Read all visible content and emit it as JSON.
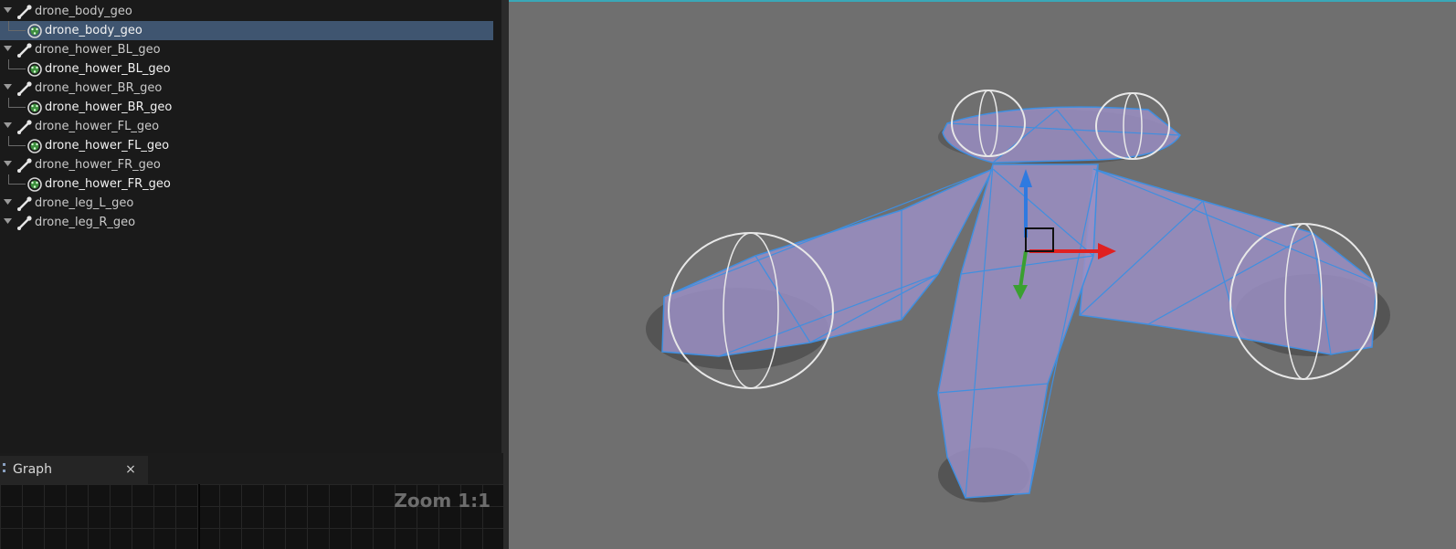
{
  "outliner": {
    "items": [
      {
        "label": "drone_body_geo",
        "type": "bone",
        "indent": 0,
        "selected": false
      },
      {
        "label": "drone_body_geo",
        "type": "mesh",
        "indent": 1,
        "selected": true
      },
      {
        "label": "drone_hower_BL_geo",
        "type": "bone",
        "indent": 0,
        "selected": false
      },
      {
        "label": "drone_hower_BL_geo",
        "type": "mesh",
        "indent": 1,
        "selected": false
      },
      {
        "label": "drone_hower_BR_geo",
        "type": "bone",
        "indent": 0,
        "selected": false
      },
      {
        "label": "drone_hower_BR_geo",
        "type": "mesh",
        "indent": 1,
        "selected": false
      },
      {
        "label": "drone_hower_FL_geo",
        "type": "bone",
        "indent": 0,
        "selected": false
      },
      {
        "label": "drone_hower_FL_geo",
        "type": "mesh",
        "indent": 1,
        "selected": false
      },
      {
        "label": "drone_hower_FR_geo",
        "type": "bone",
        "indent": 0,
        "selected": false
      },
      {
        "label": "drone_hower_FR_geo",
        "type": "mesh",
        "indent": 1,
        "selected": false
      },
      {
        "label": "drone_leg_L_geo",
        "type": "bone",
        "indent": 0,
        "selected": false
      },
      {
        "label": "drone_leg_R_geo",
        "type": "bone",
        "indent": 0,
        "selected": false
      }
    ]
  },
  "graph": {
    "tab_label": "Graph",
    "close_symbol": "×",
    "zoom_label": "Zoom 1:1"
  },
  "viewport": {
    "mesh_color": "#9b8fc4",
    "wire_color": "#3f8fe0",
    "gizmo_x_color": "#e02020",
    "gizmo_y_color": "#3aa030",
    "gizmo_z_color": "#2f7ae0"
  }
}
